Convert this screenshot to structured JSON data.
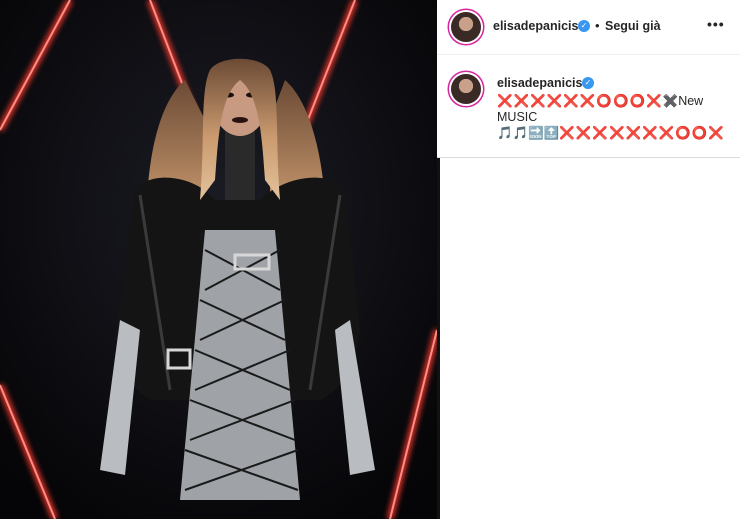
{
  "post": {
    "username": "elisadepanicis",
    "follow_label": "Segui già",
    "more_label": "•••",
    "verified_mark": "✓",
    "dot": "•"
  },
  "caption": {
    "username": "elisadepanicis",
    "line1_symbols": "❌❌❌❌❌❌⭕⭕⭕❌",
    "line1_text": "✖️New MUSIC",
    "line2_symbols": "🎵🎵🔜🔝",
    "line2_marks": "❌❌❌❌❌❌❌⭕⭕❌"
  },
  "icons": {
    "verified": "verified-badge-icon",
    "more": "more-options-icon"
  },
  "colors": {
    "verified_blue": "#3897f0",
    "photo_background": "#0b0b0f",
    "neon_red": "#ff3b2f"
  }
}
